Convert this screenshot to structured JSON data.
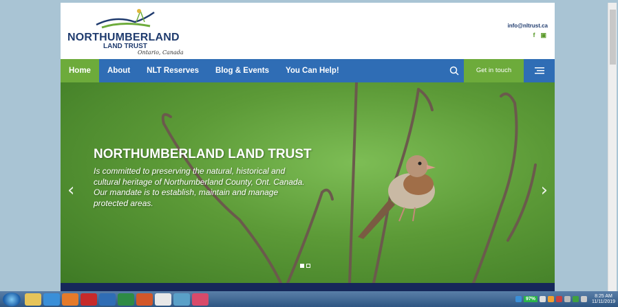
{
  "brand": {
    "name": "NORTHUMBERLAND",
    "sub": "LAND TRUST",
    "place": "Ontario, Canada"
  },
  "contact": {
    "email": "info@nltrust.ca",
    "facebook_glyph": "f",
    "youtube_glyph": "▣"
  },
  "nav": {
    "items": [
      {
        "label": "Home",
        "active": true
      },
      {
        "label": "About"
      },
      {
        "label": "NLT Reserves"
      },
      {
        "label": "Blog & Events"
      },
      {
        "label": "You Can Help!"
      }
    ],
    "cta": "Get in touch",
    "search_icon": "search-icon",
    "menu_icon": "hamburger-icon"
  },
  "hero": {
    "title": "NORTHUMBERLAND LAND TRUST",
    "text": "Is committed to preserving the natural, historical and cultural heritage of Northumberland County, Ont. Canada. Our mandate is to establish, maintain and manage protected areas.",
    "prev": "‹",
    "next": "›"
  },
  "taskbar": {
    "battery": "97%",
    "time": "8:25 AM",
    "date": "11/11/2019"
  },
  "colors": {
    "nav_blue": "#2f6db5",
    "accent_green": "#6dab3b",
    "brand_navy": "#1f3b6e"
  }
}
